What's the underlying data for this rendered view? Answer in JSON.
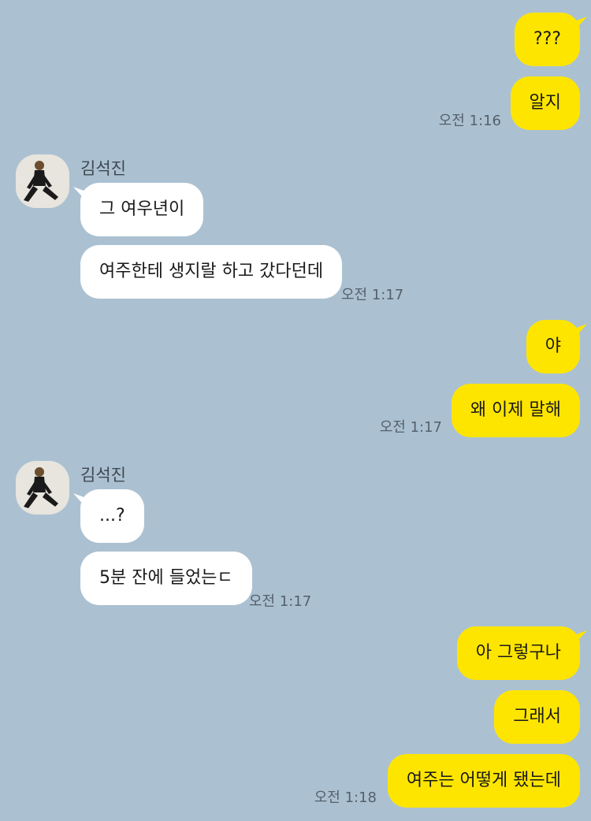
{
  "sender_name": "김석진",
  "messages": {
    "m1": "???",
    "m2": "알지",
    "m3": "그 여우년이",
    "m4": "여주한테 생지랄 하고 갔다던데",
    "m5": "야",
    "m6": "왜 이제 말해",
    "m7": "...?",
    "m8": "5분 잔에 들었는ㄷ",
    "m9": "아 그렇구나",
    "m10": "그래서",
    "m11": "여주는 어떻게 됐는데"
  },
  "times": {
    "t1": "오전 1:16",
    "t2": "오전 1:17",
    "t3": "오전 1:17",
    "t4": "오전 1:17",
    "t5": "오전 1:18"
  },
  "colors": {
    "background": "#abc1d1",
    "my_bubble": "#fee500",
    "other_bubble": "#ffffff"
  }
}
